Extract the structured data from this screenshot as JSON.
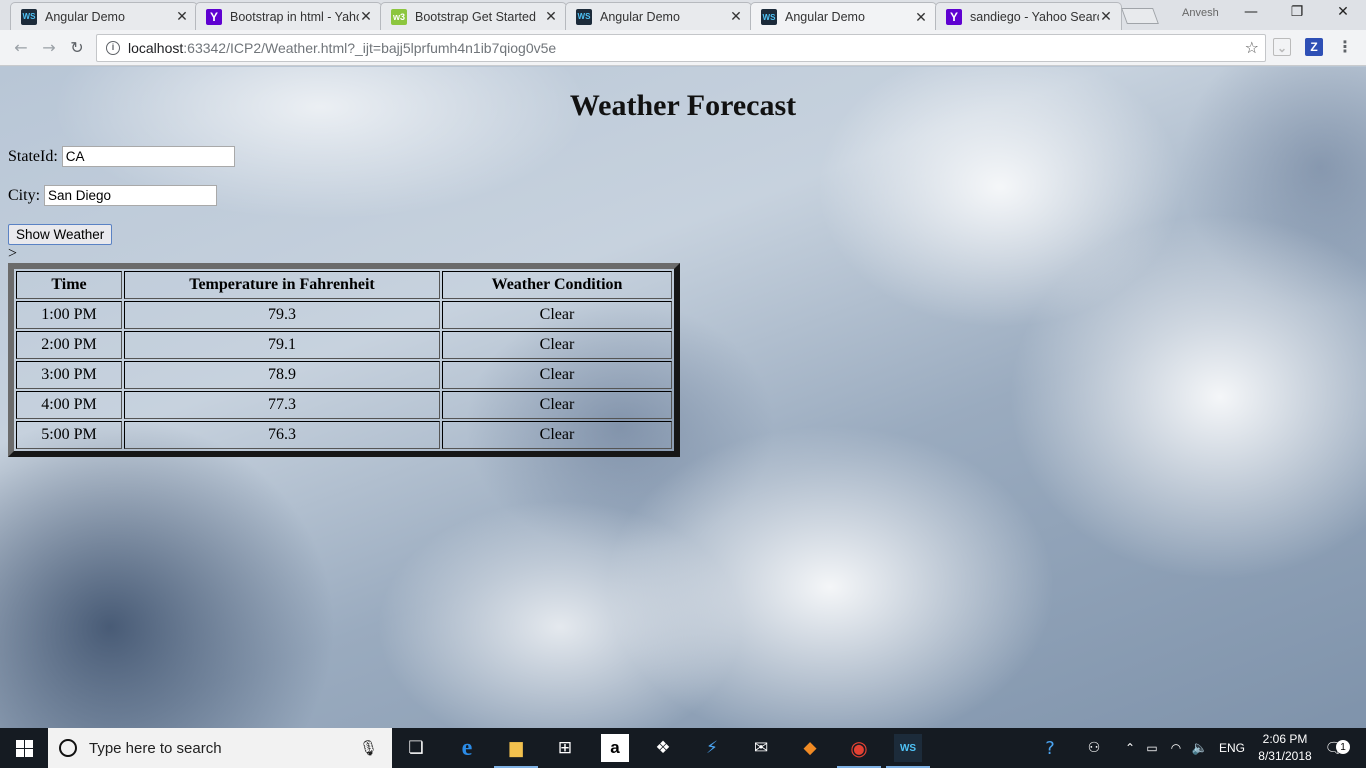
{
  "browser": {
    "tabs": [
      {
        "title": "Angular Demo",
        "favicon": "WS"
      },
      {
        "title": "Bootstrap in html - Yaho",
        "favicon": "Y"
      },
      {
        "title": "Bootstrap Get Started",
        "favicon": "w3"
      },
      {
        "title": "Angular Demo",
        "favicon": "WS"
      },
      {
        "title": "Angular Demo",
        "favicon": "WS"
      },
      {
        "title": "sandiego - Yahoo Searc",
        "favicon": "Y"
      }
    ],
    "active_tab_index": 4,
    "profile_name": "Anvesh",
    "url_host": "localhost",
    "url_path": ":63342/ICP2/Weather.html?_ijt=bajj5lprfumh4n1ib7qiog0v5e",
    "ext_z_label": "Z"
  },
  "page": {
    "title": "Weather Forecast",
    "state_label": "StateId:",
    "state_value": "CA",
    "city_label": "City:",
    "city_value": "San Diego",
    "button_label": "Show Weather",
    "stray_text": ">",
    "table": {
      "headers": [
        "Time",
        "Temperature in Fahrenheit",
        "Weather Condition"
      ],
      "rows": [
        [
          "1:00 PM",
          "79.3",
          "Clear"
        ],
        [
          "2:00 PM",
          "79.1",
          "Clear"
        ],
        [
          "3:00 PM",
          "78.9",
          "Clear"
        ],
        [
          "4:00 PM",
          "77.3",
          "Clear"
        ],
        [
          "5:00 PM",
          "76.3",
          "Clear"
        ]
      ]
    }
  },
  "taskbar": {
    "search_placeholder": "Type here to search",
    "language": "ENG",
    "time": "2:06 PM",
    "date": "8/31/2018",
    "notification_count": "1"
  }
}
